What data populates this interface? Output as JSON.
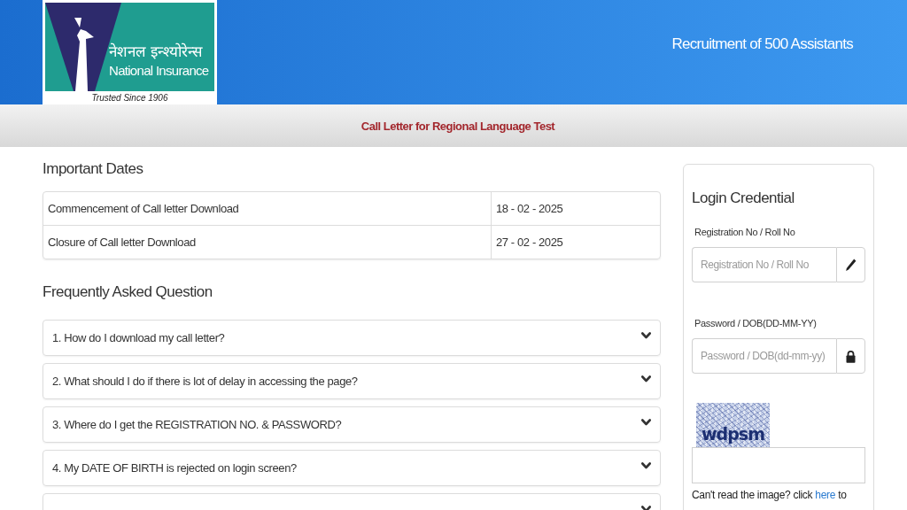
{
  "header": {
    "logo": {
      "hindi_name": "नेशनल इन्श्योरेन्स",
      "name": "National Insurance",
      "tagline": "Trusted Since 1906"
    },
    "title": "Recruitment of 500 Assistants"
  },
  "banner": {
    "title": "Call Letter for Regional Language Test"
  },
  "important_dates": {
    "heading": "Important Dates",
    "rows": [
      {
        "event": "Commencement of Call letter Download",
        "date": "18 - 02 - 2025"
      },
      {
        "event": "Closure of Call letter Download",
        "date": "27 - 02 - 2025"
      }
    ]
  },
  "faq": {
    "heading": "Frequently Asked Question",
    "items": [
      {
        "question": "1. How do I download my call letter?",
        "expanded": false
      },
      {
        "question": "2. What should I do if there is lot of delay in accessing the page?",
        "expanded": false
      },
      {
        "question": "3. Where do I get the REGISTRATION NO. & PASSWORD?",
        "expanded": false
      },
      {
        "question": "4. My DATE OF BIRTH is rejected on login screen?",
        "expanded": false
      },
      {
        "expanded": false
      }
    ]
  },
  "login": {
    "title": "Login Credential",
    "fields": [
      {
        "kind": "text",
        "label": "Registration No / Roll No",
        "placeholder": "Registration No / Roll No"
      },
      {
        "kind": "password",
        "label": "Password / DOB(DD-MM-YY)",
        "placeholder": "Password / DOB(dd-mm-yy)"
      }
    ],
    "captcha": {
      "image_text": "wdpsm"
    },
    "help": {
      "before": "Can't read the image? click ",
      "link": "here",
      "after": " to"
    }
  }
}
